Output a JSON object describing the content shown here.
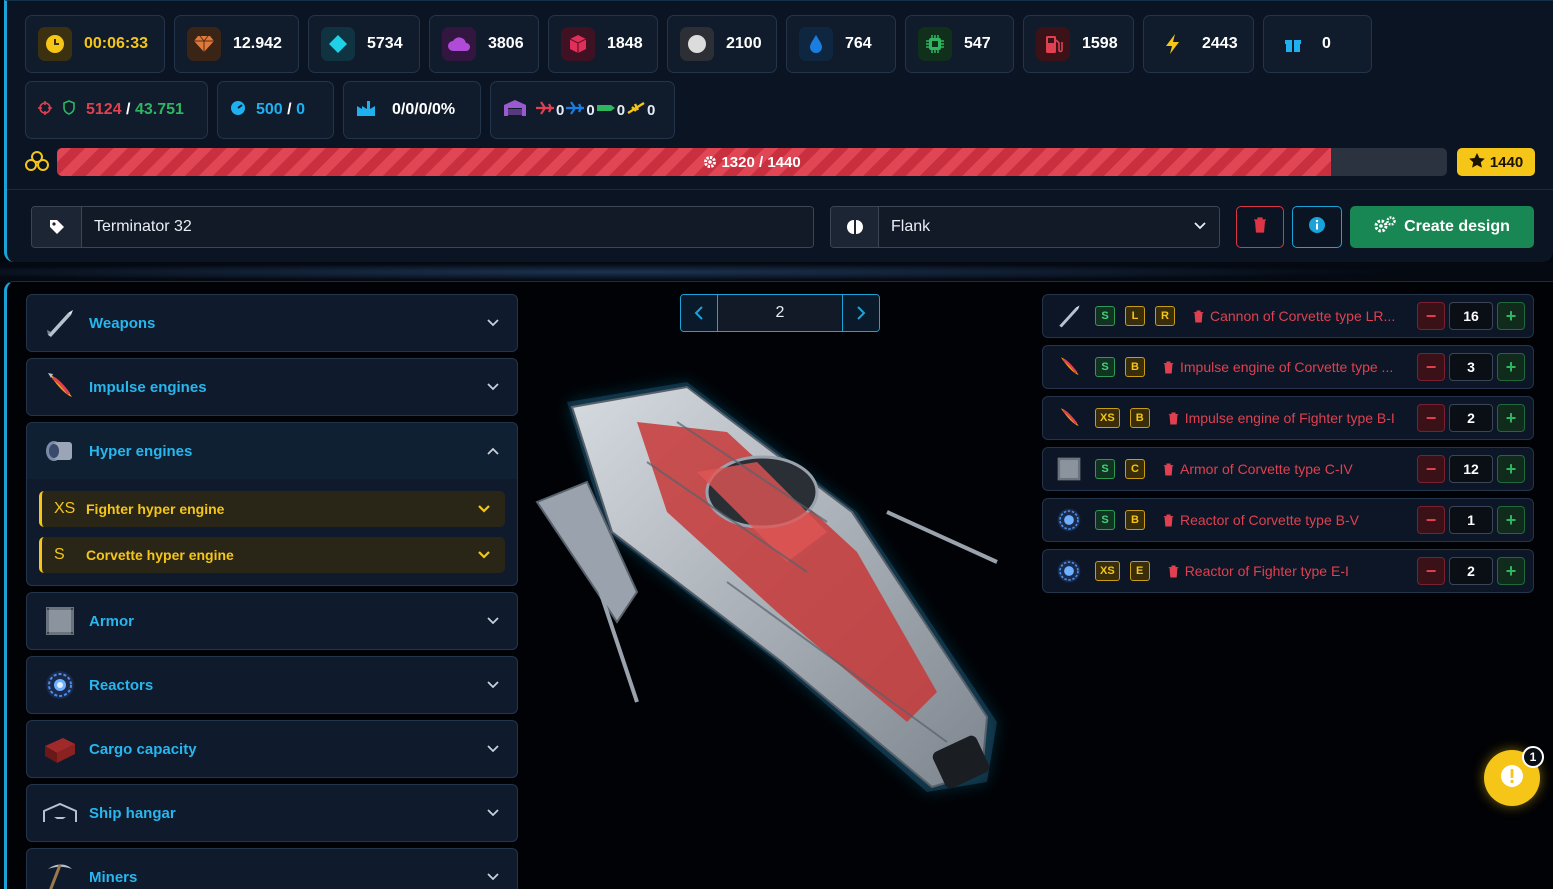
{
  "resources": {
    "row1": [
      {
        "name": "time",
        "icon": "clock-icon",
        "value": "00:06:33",
        "color": "#f5c518"
      },
      {
        "name": "crystal",
        "icon": "gem-icon",
        "value": "12.942",
        "color": "#e07a3a"
      },
      {
        "name": "diamond",
        "icon": "diamond-icon",
        "value": "5734",
        "color": "#1fd1e6"
      },
      {
        "name": "gas",
        "icon": "cloud-icon",
        "value": "3806",
        "color": "#b04bd8"
      },
      {
        "name": "cube",
        "icon": "cube-icon",
        "value": "1848",
        "color": "#e0305a"
      },
      {
        "name": "orb",
        "icon": "circle-icon",
        "value": "2100",
        "color": "#dcdcdc"
      },
      {
        "name": "water",
        "icon": "droplet-icon",
        "value": "764",
        "color": "#1a7de0"
      },
      {
        "name": "chip",
        "icon": "chip-icon",
        "value": "547",
        "color": "#2fb660"
      },
      {
        "name": "fuel",
        "icon": "fuel-pump-icon",
        "value": "1598",
        "color": "#e0404f"
      },
      {
        "name": "energy",
        "icon": "lightning-icon",
        "value": "2443",
        "color": "#f5c518"
      },
      {
        "name": "gift",
        "icon": "gift-icon",
        "value": "0",
        "color": "#1fb0f0"
      }
    ],
    "row2": {
      "combat": {
        "current": "5124",
        "sep": "/",
        "max": "43.751"
      },
      "speed": {
        "current": "500",
        "sep": "/",
        "max": "0"
      },
      "stats": "0/0/0/0%",
      "hangar": {
        "counts": [
          "0",
          "0",
          "0",
          "0"
        ]
      }
    }
  },
  "progress": {
    "label": "1320 / 1440",
    "current": 1320,
    "max": 1440,
    "stars": "1440"
  },
  "design": {
    "name": "Terminator 32",
    "strategy": "Flank",
    "create_label": "Create design"
  },
  "categories": [
    {
      "key": "weapons",
      "label": "Weapons",
      "icon": "missile-icon",
      "open": false
    },
    {
      "key": "impulse",
      "label": "Impulse engines",
      "icon": "rocket-flame-icon",
      "open": false
    },
    {
      "key": "hyper",
      "label": "Hyper engines",
      "icon": "hyper-engine-icon",
      "open": true,
      "items": [
        {
          "size": "XS",
          "label": "Fighter hyper engine"
        },
        {
          "size": "S",
          "label": "Corvette hyper engine"
        }
      ]
    },
    {
      "key": "armor",
      "label": "Armor",
      "icon": "armor-plate-icon",
      "open": false
    },
    {
      "key": "reactors",
      "label": "Reactors",
      "icon": "reactor-icon",
      "open": false
    },
    {
      "key": "cargo",
      "label": "Cargo capacity",
      "icon": "cargo-crate-icon",
      "open": false
    },
    {
      "key": "hangar",
      "label": "Ship hangar",
      "icon": "hangar-icon",
      "open": false
    },
    {
      "key": "miners",
      "label": "Miners",
      "icon": "pickaxe-icon",
      "open": false
    }
  ],
  "pager": {
    "value": "2"
  },
  "modules": [
    {
      "icon": "missile-icon",
      "tags": [
        {
          "t": "S",
          "c": "green"
        },
        {
          "t": "L",
          "c": "yellow"
        },
        {
          "t": "R",
          "c": "yellow"
        }
      ],
      "name": "Cannon of Corvette type LR...",
      "qty": "16"
    },
    {
      "icon": "rocket-flame-icon",
      "tags": [
        {
          "t": "S",
          "c": "green"
        },
        {
          "t": "B",
          "c": "yellow"
        }
      ],
      "name": "Impulse engine of Corvette type ...",
      "qty": "3"
    },
    {
      "icon": "rocket-flame-icon",
      "tags": [
        {
          "t": "XS",
          "c": "yellow"
        },
        {
          "t": "B",
          "c": "yellow"
        }
      ],
      "name": "Impulse engine of Fighter type B-I",
      "qty": "2"
    },
    {
      "icon": "armor-plate-icon",
      "tags": [
        {
          "t": "S",
          "c": "green"
        },
        {
          "t": "C",
          "c": "yellow"
        }
      ],
      "name": "Armor of Corvette type C-IV",
      "qty": "12"
    },
    {
      "icon": "reactor-icon",
      "tags": [
        {
          "t": "S",
          "c": "green"
        },
        {
          "t": "B",
          "c": "yellow"
        }
      ],
      "name": "Reactor of Corvette type B-V",
      "qty": "1"
    },
    {
      "icon": "reactor-icon",
      "tags": [
        {
          "t": "XS",
          "c": "yellow"
        },
        {
          "t": "E",
          "c": "yellow"
        }
      ],
      "name": "Reactor of Fighter type E-I",
      "qty": "2"
    }
  ],
  "notifications": {
    "count": "1"
  }
}
